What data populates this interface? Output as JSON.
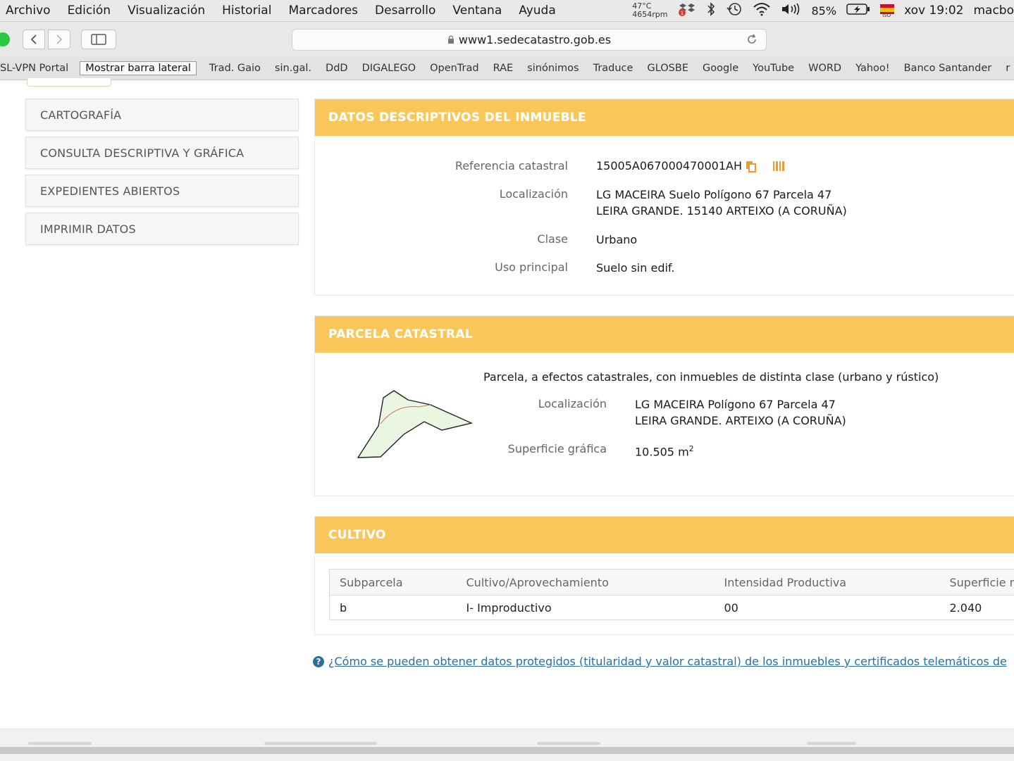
{
  "menubar": {
    "items": [
      "Archivo",
      "Edición",
      "Visualización",
      "Historial",
      "Marcadores",
      "Desarrollo",
      "Ventana",
      "Ayuda"
    ],
    "temp": "47°C",
    "rpm": "4654rpm",
    "battery": "85%",
    "clock": "xov 19:02",
    "user": "macbo"
  },
  "toolbar": {
    "url": "www1.sedecatastro.gob.es"
  },
  "bookmarks": {
    "first": "SL-VPN Portal",
    "tooltip": "Mostrar barra lateral",
    "items": [
      "Trad. Gaio",
      "sin.gal.",
      "DdD",
      "DIGALEGO",
      "OpenTrad",
      "RAE",
      "sinónimos",
      "Traduce",
      "GLOSBE",
      "Google",
      "YouTube",
      "WORD",
      "Yahoo!",
      "Banco Santander",
      "r"
    ]
  },
  "side_menu": [
    "CARTOGRAFÍA",
    "CONSULTA DESCRIPTIVA Y GRÁFICA",
    "EXPEDIENTES ABIERTOS",
    "IMPRIMIR DATOS"
  ],
  "inmueble": {
    "title": "DATOS DESCRIPTIVOS DEL INMUEBLE",
    "ref_label": "Referencia catastral",
    "ref_value": "15005A067000470001AH",
    "loc_label": "Localización",
    "loc_line1": "LG MACEIRA Suelo Polígono 67 Parcela 47",
    "loc_line2": "LEIRA GRANDE. 15140 ARTEIXO (A CORUÑA)",
    "clase_label": "Clase",
    "clase_value": "Urbano",
    "uso_label": "Uso principal",
    "uso_value": "Suelo sin edif."
  },
  "parcela": {
    "title": "PARCELA CATASTRAL",
    "note": "Parcela, a efectos catastrales, con inmuebles de distinta clase (urbano y rústico)",
    "loc_label": "Localización",
    "loc_line1": "LG MACEIRA Polígono 67 Parcela 47",
    "loc_line2": "LEIRA GRANDE. ARTEIXO (A CORUÑA)",
    "sup_label": "Superficie gráfica",
    "sup_value": "10.505 m",
    "sup_unit_sup": "2"
  },
  "cultivo": {
    "title": "CULTIVO",
    "headers": [
      "Subparcela",
      "Cultivo/Aprovechamiento",
      "Intensidad Productiva",
      "Superficie m"
    ],
    "rows": [
      [
        "b",
        "I- Improductivo",
        "00",
        "2.040"
      ]
    ]
  },
  "help_link": "¿Cómo se pueden obtener datos protegidos (titularidad y valor catastral) de los inmuebles y certificados telemáticos de"
}
